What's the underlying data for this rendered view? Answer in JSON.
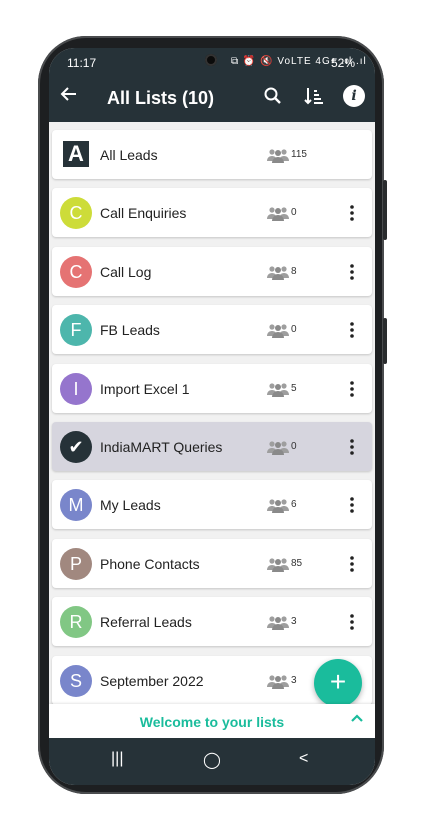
{
  "status_bar": {
    "time": "11:17",
    "icons": "⧉ ⏰ 🔇 VoLTE 4G+ .ıl .ıl",
    "battery": "52%"
  },
  "app_bar": {
    "back_icon": "arrow-left-icon",
    "title": "All Lists (10)",
    "search_icon": "search-icon",
    "sort_icon": "sort-icon",
    "info_icon": "info-icon",
    "info_glyph": "i"
  },
  "lists": [
    {
      "name": "All Leads",
      "count": "115",
      "avatar": "A",
      "avatar_color": "#263238",
      "type": "square"
    },
    {
      "name": "Call Enquiries",
      "count": "0",
      "avatar": "C",
      "avatar_color": "#cddc39"
    },
    {
      "name": "Call Log",
      "count": "8",
      "avatar": "C",
      "avatar_color": "#e57373"
    },
    {
      "name": "FB Leads",
      "count": "0",
      "avatar": "F",
      "avatar_color": "#4db6ac"
    },
    {
      "name": "Import Excel 1",
      "count": "5",
      "avatar": "I",
      "avatar_color": "#9575cd"
    },
    {
      "name": "IndiaMART Queries",
      "count": "0",
      "avatar": "✔",
      "avatar_color": "#263238",
      "selected": true
    },
    {
      "name": "My Leads",
      "count": "6",
      "avatar": "M",
      "avatar_color": "#7986cb"
    },
    {
      "name": "Phone Contacts",
      "count": "85",
      "avatar": "P",
      "avatar_color": "#a1887f"
    },
    {
      "name": "Referral Leads",
      "count": "3",
      "avatar": "R",
      "avatar_color": "#81c784"
    },
    {
      "name": "September 2022",
      "count": "3",
      "avatar": "S",
      "avatar_color": "#7986cb"
    }
  ],
  "fab": {
    "label": "+"
  },
  "footer": {
    "welcome": "Welcome to your lists",
    "chevron": "^"
  },
  "navbar": {
    "recent": "|||",
    "home": "◯",
    "back": "<"
  },
  "colors": {
    "primary": "#263238",
    "accent": "#1abc9c",
    "selected": "#d6d5de"
  }
}
